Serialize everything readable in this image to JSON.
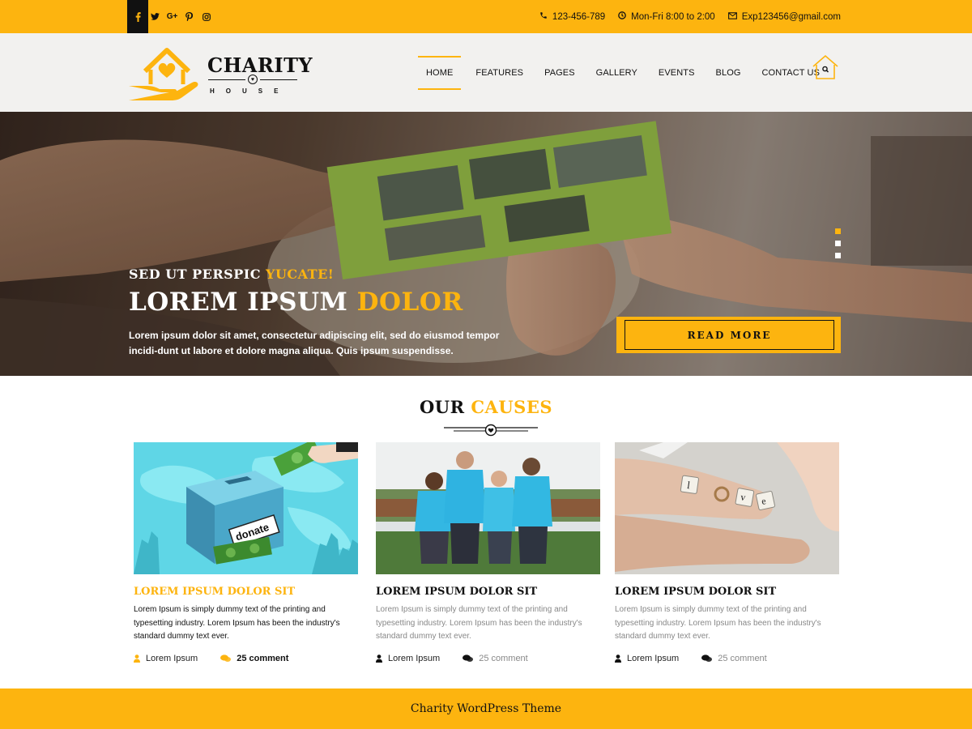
{
  "topbar": {
    "social": [
      "facebook-icon",
      "twitter-icon",
      "google-plus-icon",
      "pinterest-icon",
      "instagram-icon"
    ],
    "phone": "123-456-789",
    "hours": "Mon-Fri 8:00 to 2:00",
    "email": "Exp123456@gmail.com"
  },
  "logo": {
    "name": "CHARITY",
    "tagline": "HOUSE"
  },
  "nav": {
    "items": [
      "HOME",
      "FEATURES",
      "PAGES",
      "GALLERY",
      "EVENTS",
      "BLOG",
      "CONTACT US"
    ],
    "active": "HOME"
  },
  "hero": {
    "subtitle_main": "SED UT PERSPIC ",
    "subtitle_accent": "YUCATE!",
    "title_main": "LOREM IPSUM ",
    "title_accent": "DOLOR",
    "text": "Lorem ipsum dolor sit amet, consectetur adipiscing elit, sed do eiusmod tempor incidi-dunt ut labore et dolore magna aliqua. Quis ipsum suspendisse.",
    "button": "READ MORE",
    "slides": 3,
    "active_slide": 1
  },
  "causes": {
    "title_main": "OUR ",
    "title_accent": "CAUSES",
    "cards": [
      {
        "title": "LOREM IPSUM DOLOR SIT",
        "text": "Lorem Ipsum is simply dummy text of the printing and typesetting industry. Lorem Ipsum has been the industry's standard dummy text ever.",
        "author": "Lorem Ipsum",
        "comments": "25 comment",
        "image": "donate box illustration"
      },
      {
        "title": "LOREM IPSUM DOLOR SIT",
        "text": "Lorem Ipsum is simply dummy text of the printing and typesetting industry. Lorem Ipsum has been the industry's standard dummy text ever.",
        "author": "Lorem Ipsum",
        "comments": "25 comment",
        "image": "volunteers photo"
      },
      {
        "title": "LOREM IPSUM DOLOR SIT",
        "text": "Lorem Ipsum is simply dummy text of the printing and typesetting industry. Lorem Ipsum has been the industry's standard dummy text ever.",
        "author": "Lorem Ipsum",
        "comments": "25 comment",
        "image": "hands with love tiles photo"
      }
    ]
  },
  "footer": {
    "text": "Charity WordPress Theme"
  },
  "colors": {
    "accent": "#fdb40f",
    "dark": "#111111",
    "muted": "#888888"
  }
}
